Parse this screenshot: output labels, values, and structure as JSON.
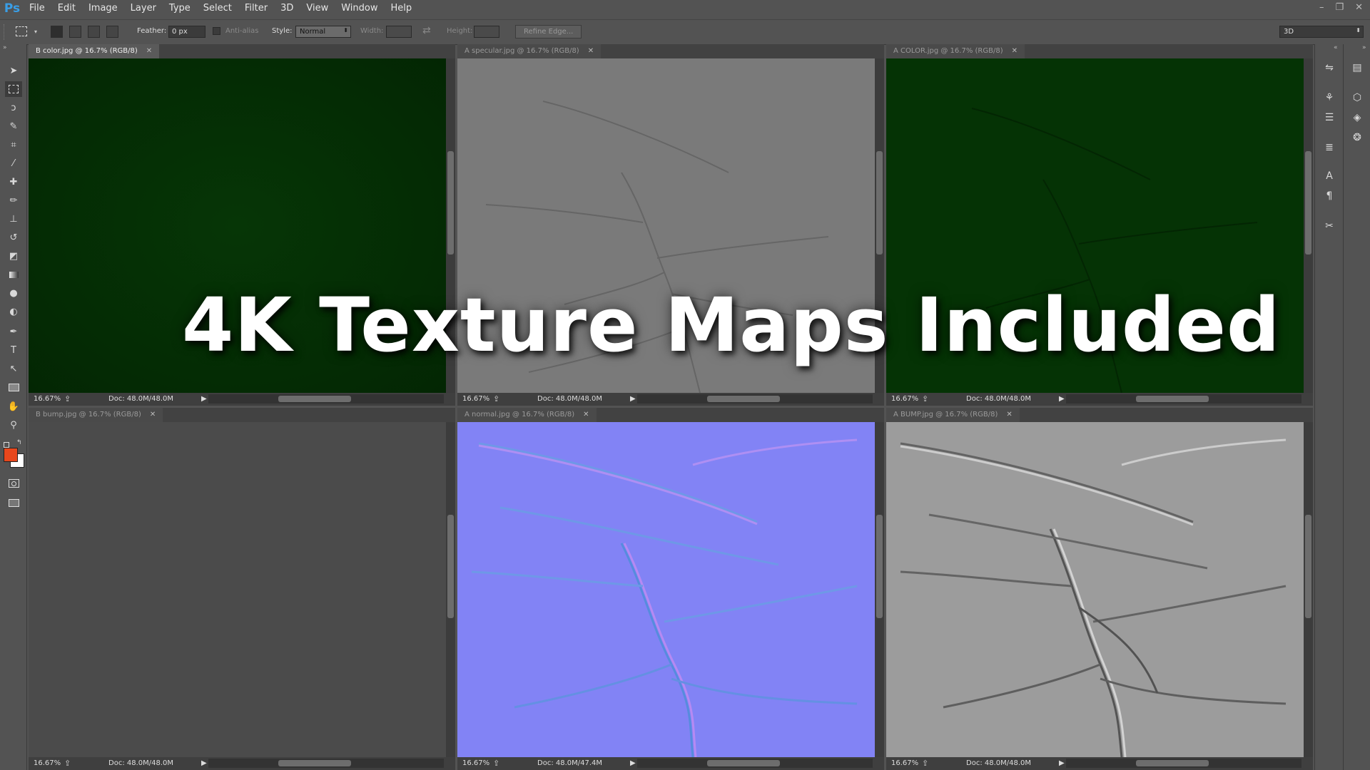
{
  "app": {
    "logo": "Ps"
  },
  "menu": [
    "File",
    "Edit",
    "Image",
    "Layer",
    "Type",
    "Select",
    "Filter",
    "3D",
    "View",
    "Window",
    "Help"
  ],
  "window_controls": {
    "minimize": "–",
    "restore": "❐",
    "close": "✕"
  },
  "options": {
    "feather_label": "Feather:",
    "feather_value": "0 px",
    "antialias_label": "Anti-alias",
    "style_label": "Style:",
    "style_value": "Normal",
    "width_label": "Width:",
    "height_label": "Height:",
    "refine_edge": "Refine Edge...",
    "workspace": "3D",
    "swap_icon": "⇄"
  },
  "colors": {
    "foreground": "#e8471c",
    "background": "#ffffff",
    "diffuse_green": "#032d03",
    "normal_blue": "#8283f5",
    "bump_gray": "#9c9c9c"
  },
  "documents": [
    {
      "title": "B color.jpg @ 16.7% (RGB/8)",
      "zoom": "16.67%",
      "doc": "Doc: 48.0M/48.0M",
      "active": true,
      "map": "diffuse-green"
    },
    {
      "title": "A specular.jpg @ 16.7% (RGB/8)",
      "zoom": "16.67%",
      "doc": "Doc: 48.0M/48.0M",
      "active": false,
      "map": "specular-gray"
    },
    {
      "title": "A COLOR.jpg @ 16.7% (RGB/8)",
      "zoom": "16.67%",
      "doc": "Doc: 48.0M/48.0M",
      "active": false,
      "map": "diffuse-green"
    },
    {
      "title": "B bump.jpg @ 16.7% (RGB/8)",
      "zoom": "16.67%",
      "doc": "Doc: 48.0M/48.0M",
      "active": false,
      "map": "bump-dark"
    },
    {
      "title": "A normal.jpg @ 16.7% (RGB/8)",
      "zoom": "16.67%",
      "doc": "Doc: 48.0M/47.4M",
      "active": false,
      "map": "normal-blue"
    },
    {
      "title": "A BUMP.jpg @ 16.7% (RGB/8)",
      "zoom": "16.67%",
      "doc": "Doc: 48.0M/48.0M",
      "active": false,
      "map": "bump-gray"
    }
  ],
  "overlay": {
    "headline": "4K Texture Maps Included"
  },
  "tools": [
    "move-icon",
    "rectangular-marquee-icon",
    "lasso-icon",
    "quick-selection-icon",
    "crop-icon",
    "eyedropper-icon",
    "spot-healing-icon",
    "brush-icon",
    "clone-stamp-icon",
    "history-brush-icon",
    "eraser-icon",
    "gradient-icon",
    "blur-icon",
    "dodge-icon",
    "pen-icon",
    "type-icon",
    "path-selection-icon",
    "rectangle-shape-icon",
    "hand-icon",
    "zoom-icon"
  ],
  "tool_glyphs": {
    "type": "T",
    "hand": "✋",
    "zoom": "⚲",
    "pen": "✒",
    "eyedropper": "⁄",
    "move": "➤"
  }
}
